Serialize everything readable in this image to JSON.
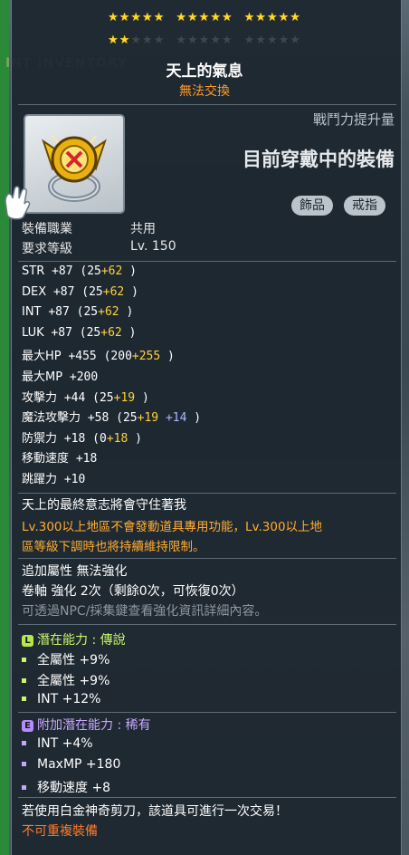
{
  "stars": {
    "filled": 2,
    "total": 30
  },
  "item": {
    "name": "天上的氣息",
    "trade": "無法交換"
  },
  "header": {
    "power_label": "戰鬥力提升量",
    "equipped": "目前穿戴中的裝備",
    "tags": [
      "飾品",
      "戒指"
    ]
  },
  "requirements": [
    {
      "label": "裝備職業",
      "value": "共用"
    },
    {
      "label": "要求等級",
      "value": "Lv. 150"
    }
  ],
  "stats": [
    {
      "name": "STR",
      "total": "+87",
      "base": "(25",
      "bonus": "+62",
      "bonus2": "",
      "close": ")"
    },
    {
      "name": "DEX",
      "total": "+87",
      "base": "(25",
      "bonus": "+62",
      "bonus2": "",
      "close": ")"
    },
    {
      "name": "INT",
      "total": "+87",
      "base": "(25",
      "bonus": "+62",
      "bonus2": "",
      "close": ")"
    },
    {
      "name": "LUK",
      "total": "+87",
      "base": "(25",
      "bonus": "+62",
      "bonus2": "",
      "close": ")"
    },
    {
      "name": "最大HP",
      "total": "+455",
      "base": "(200",
      "bonus": "+255",
      "bonus2": "",
      "close": ")"
    },
    {
      "name": "最大MP",
      "total": "+200",
      "base": "",
      "bonus": "",
      "bonus2": "",
      "close": ""
    },
    {
      "name": "攻擊力",
      "total": "+44",
      "base": "(25",
      "bonus": "+19",
      "bonus2": "",
      "close": ")"
    },
    {
      "name": "魔法攻擊力",
      "total": "+58",
      "base": "(25",
      "bonus": "+19",
      "bonus2": "+14",
      "close": ")"
    },
    {
      "name": "防禦力",
      "total": "+18",
      "base": "(0",
      "bonus": "+18",
      "bonus2": "",
      "close": ")"
    },
    {
      "name": "移動速度",
      "total": "+18",
      "base": "",
      "bonus": "",
      "bonus2": "",
      "close": ""
    },
    {
      "name": "跳躍力",
      "total": "+10",
      "base": "",
      "bonus": "",
      "bonus2": "",
      "close": ""
    }
  ],
  "description": {
    "flavor": "天上的最終意志將會守住著我",
    "warning_line1": "Lv.300以上地區不會發動道具專用功能，Lv.300以上地",
    "warning_line2": "區等級下調時也將持續維持限制。"
  },
  "upgrade": {
    "line1": "追加屬性 無法強化",
    "line2": "卷軸 強化 2次（剩餘0次，可恢復0次）",
    "hint": "可透過NPC/採集鍵查看強化資訊詳細內容。"
  },
  "potential": {
    "badge": "L",
    "title": "潛在能力",
    "grade": "傳說",
    "lines": [
      "全屬性 +9%",
      "全屬性 +9%",
      "INT +12%"
    ]
  },
  "additional": {
    "badge": "E",
    "title": "附加潛在能力",
    "grade": "稀有",
    "lines": [
      "INT +4%",
      "MaxMP +180",
      "移動速度 +8"
    ]
  },
  "footer": {
    "trade_note": "若使用白金神奇剪刀，該道具可進行一次交易！",
    "flag": "不可重複裝備"
  },
  "colors": {
    "gold": "#ffd23a",
    "orange": "#ffad33",
    "legend_green": "#c9f66b",
    "epic_purple": "#c8a6ff"
  }
}
